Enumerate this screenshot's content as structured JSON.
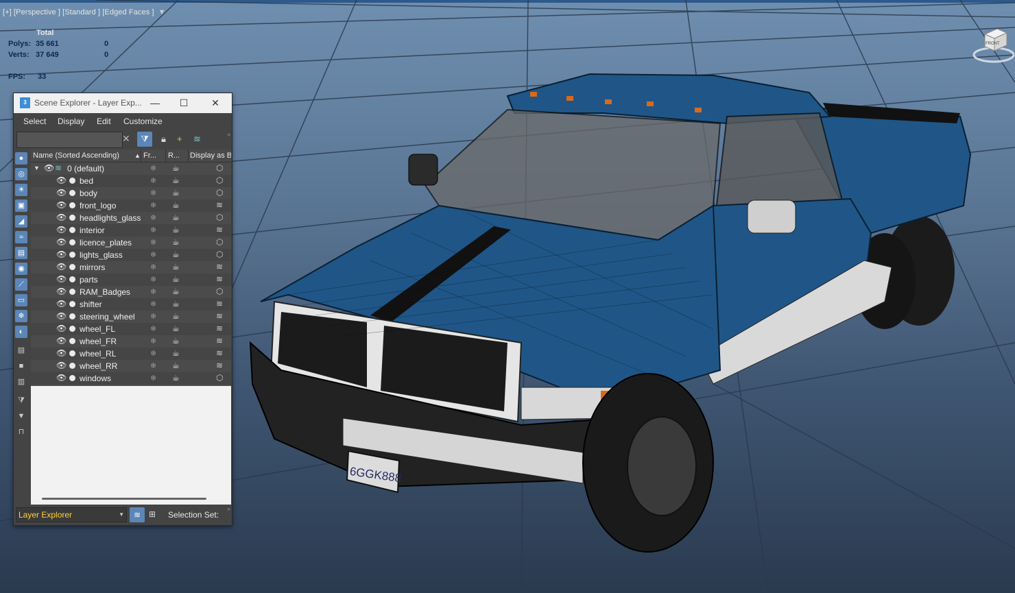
{
  "viewport": {
    "label": "[+] [Perspective ] [Standard ] [Edged Faces ]",
    "filter_icon": "funnel-icon",
    "license_plate": "6GGK888",
    "viewcube_label": "FRONT"
  },
  "stats": {
    "total_label": "Total",
    "polys_label": "Polys:",
    "polys_value": "35 661",
    "polys_selected": "0",
    "verts_label": "Verts:",
    "verts_value": "37 649",
    "verts_selected": "0",
    "fps_label": "FPS:",
    "fps_value": "33"
  },
  "scene_explorer": {
    "app_icon_text": "3",
    "title": "Scene Explorer - Layer Exp...",
    "menu": [
      "Select",
      "Display",
      "Edit",
      "Customize"
    ],
    "search_value": "",
    "columns": {
      "name": "Name (Sorted Ascending)",
      "frozen": "Fr...",
      "render": "R...",
      "display": "Display as B"
    },
    "root_layer": "0 (default)",
    "layers": [
      {
        "name": "bed",
        "display": "box"
      },
      {
        "name": "body",
        "display": "box"
      },
      {
        "name": "front_logo",
        "display": "stack"
      },
      {
        "name": "headlights_glass",
        "display": "box"
      },
      {
        "name": "interior",
        "display": "stack"
      },
      {
        "name": "licence_plates",
        "display": "box"
      },
      {
        "name": "lights_glass",
        "display": "box"
      },
      {
        "name": "mirrors",
        "display": "stack"
      },
      {
        "name": "parts",
        "display": "stack"
      },
      {
        "name": "RAM_Badges",
        "display": "box"
      },
      {
        "name": "shifter",
        "display": "stack"
      },
      {
        "name": "steering_wheel",
        "display": "stack"
      },
      {
        "name": "wheel_FL",
        "display": "stack"
      },
      {
        "name": "wheel_FR",
        "display": "stack"
      },
      {
        "name": "wheel_RL",
        "display": "stack"
      },
      {
        "name": "wheel_RR",
        "display": "stack"
      },
      {
        "name": "windows",
        "display": "box"
      }
    ],
    "bottom": {
      "explorer_select": "Layer Explorer",
      "selection_set_label": "Selection Set:"
    }
  },
  "colors": {
    "accent": "#5b86b7",
    "truck_body": "#1f5687",
    "layer_explorer_text": "#ffd43a"
  }
}
